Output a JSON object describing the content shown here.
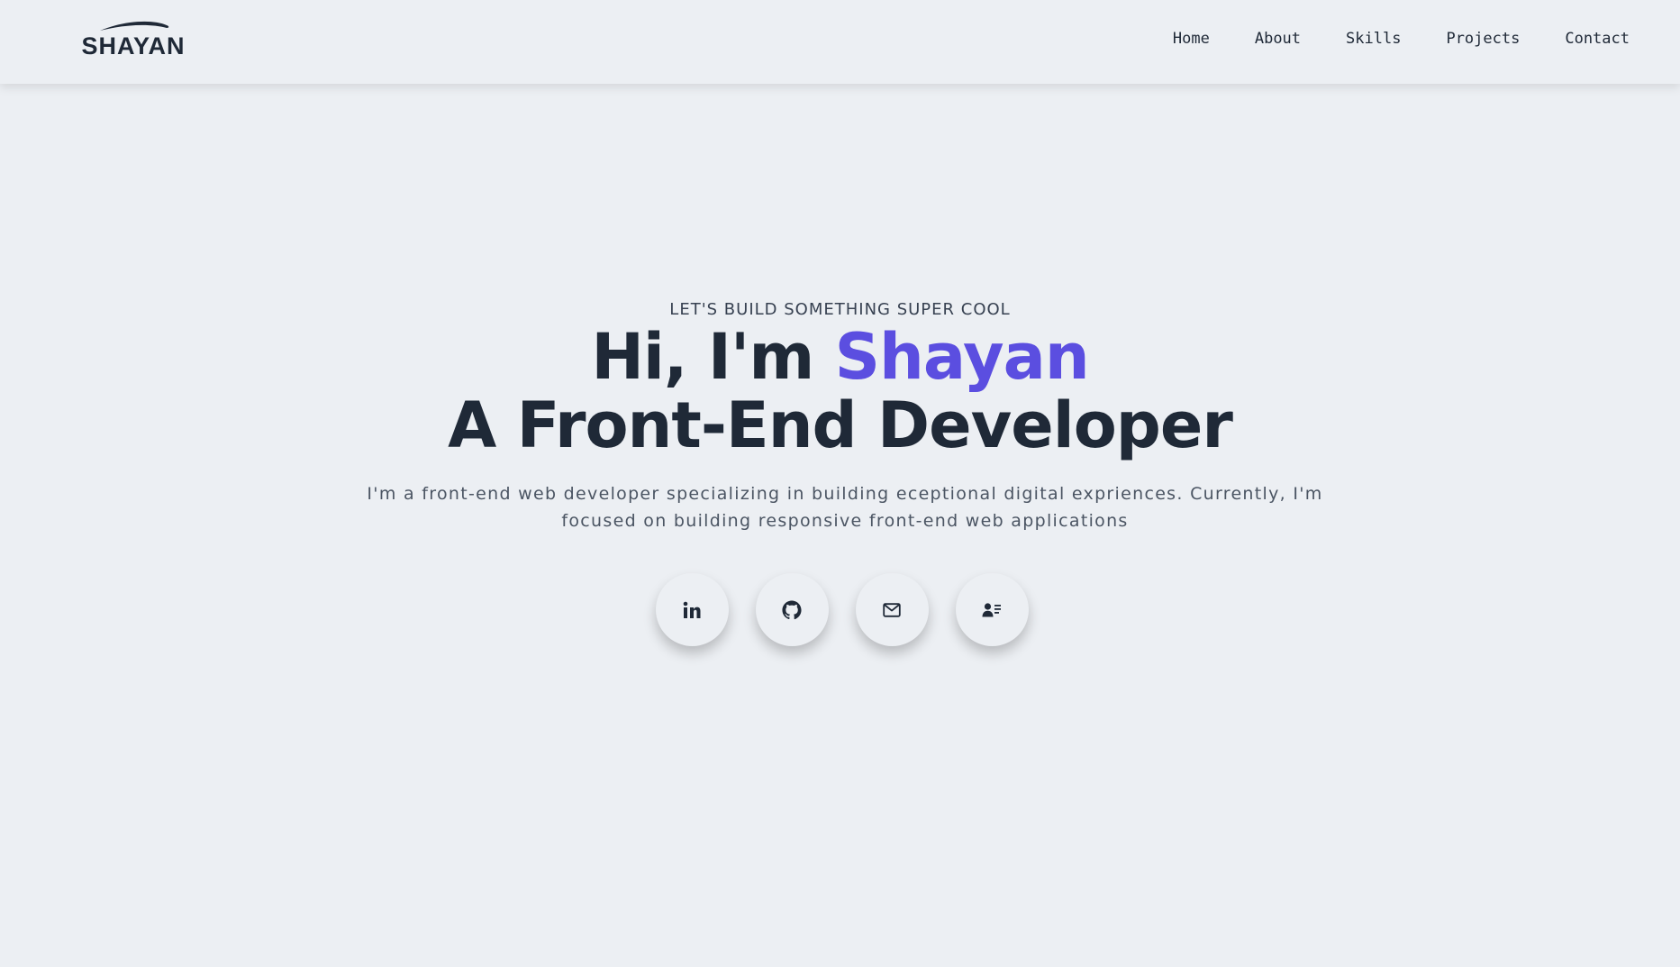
{
  "header": {
    "logo_text": "SHAYAN",
    "nav": [
      {
        "label": "Home"
      },
      {
        "label": "About"
      },
      {
        "label": "Skills"
      },
      {
        "label": "Projects"
      },
      {
        "label": "Contact"
      }
    ]
  },
  "hero": {
    "eyebrow": "LET'S BUILD SOMETHING SUPER COOL",
    "greeting_prefix": "Hi, I'm ",
    "name": "Shayan",
    "role": "A Front-End Developer",
    "description": "I'm a front-end web developer specializing in building eceptional digital expriences. Currently, I'm focused on building responsive front-end web applications",
    "socials": [
      {
        "icon": "linkedin-icon"
      },
      {
        "icon": "github-icon"
      },
      {
        "icon": "mail-icon"
      },
      {
        "icon": "contact-card-icon"
      }
    ]
  },
  "colors": {
    "background": "#eceff3",
    "text": "#1f2937",
    "accent": "#5b4ee0"
  }
}
